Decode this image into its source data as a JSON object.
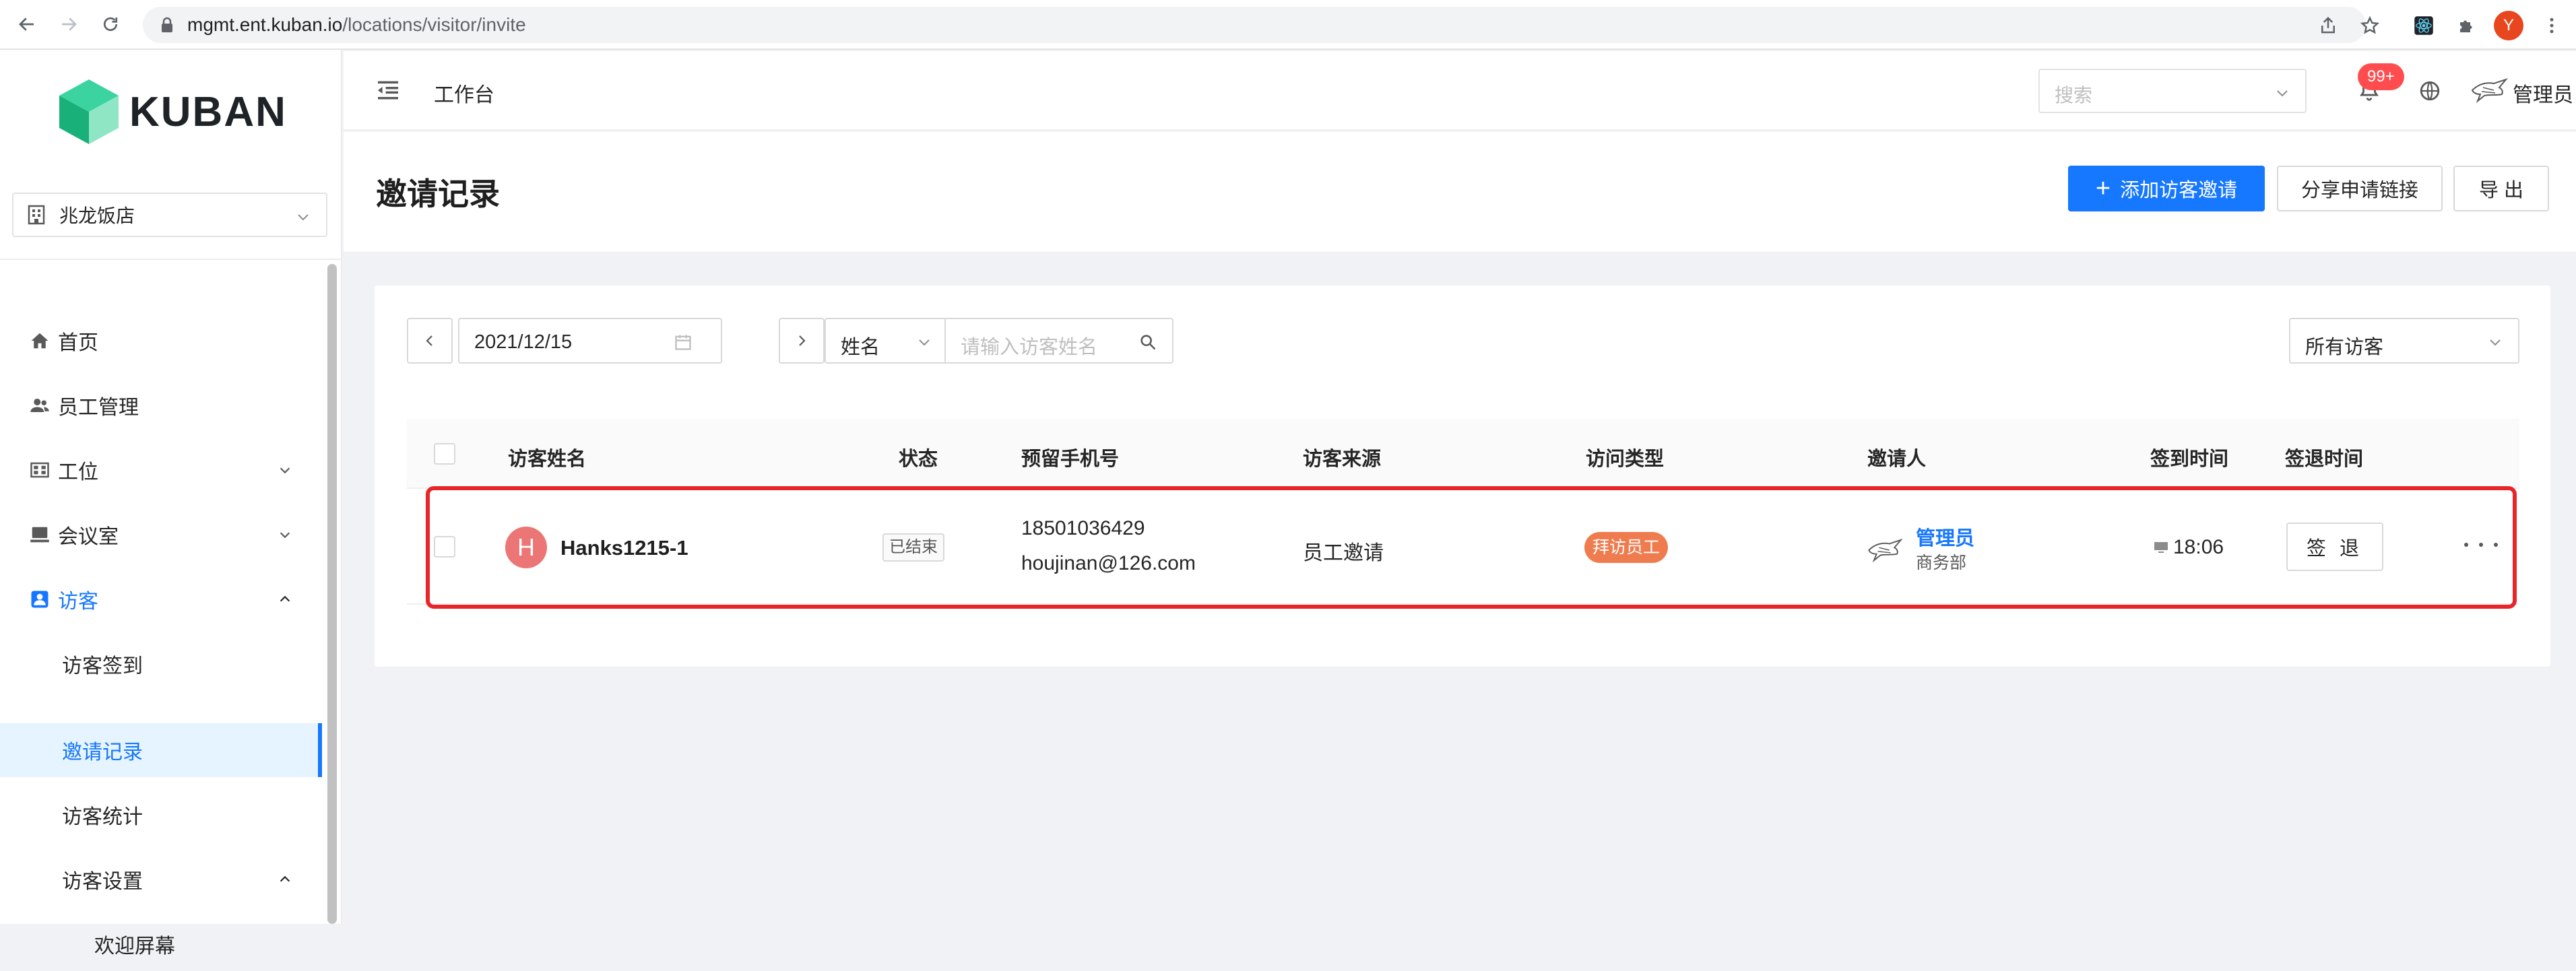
{
  "browser": {
    "url_host": "mgmt.ent.kuban.io",
    "url_path": "/locations/visitor/invite",
    "profile_initial": "Y"
  },
  "sidebar": {
    "logo_text": "KUBAN",
    "store": "兆龙饭店",
    "items": [
      {
        "label": "首页",
        "icon": "home-icon"
      },
      {
        "label": "员工管理",
        "icon": "team-icon"
      },
      {
        "label": "工位",
        "icon": "desk-icon"
      },
      {
        "label": "会议室",
        "icon": "meeting-icon"
      },
      {
        "label": "访客",
        "icon": "visitor-icon"
      },
      {
        "label": "访客签到"
      },
      {
        "label": "邀请记录"
      },
      {
        "label": "访客统计"
      },
      {
        "label": "访客设置"
      },
      {
        "label": "欢迎屏幕"
      }
    ]
  },
  "topbar": {
    "workbench": "工作台",
    "search_placeholder": "搜索",
    "notification_count": "99+",
    "admin_name": "管理员"
  },
  "page": {
    "title": "邀请记录",
    "add_invite": "添加访客邀请",
    "share_link": "分享申请链接",
    "export": "导 出"
  },
  "filters": {
    "date": "2021/12/15",
    "field": "姓名",
    "name_placeholder": "请输入访客姓名",
    "visitor_scope": "所有访客"
  },
  "table": {
    "columns": [
      "访客姓名",
      "状态",
      "预留手机号",
      "访客来源",
      "访问类型",
      "邀请人",
      "签到时间",
      "签退时间"
    ],
    "rows": [
      {
        "avatar_initial": "H",
        "name": "Hanks1215-1",
        "status": "已结束",
        "phone": "18501036429",
        "email": "houjinan@126.com",
        "source": "员工邀请",
        "visit_type": "拜访员工",
        "inviter": "管理员",
        "inviter_dept": "商务部",
        "checkin_time": "18:06",
        "checkout_label": "签 退"
      }
    ]
  },
  "colors": {
    "primary": "#1677ff",
    "highlight_border": "#e8262a",
    "visit_type_tag": "#ef7c4f",
    "avatar": "#ec7575"
  }
}
